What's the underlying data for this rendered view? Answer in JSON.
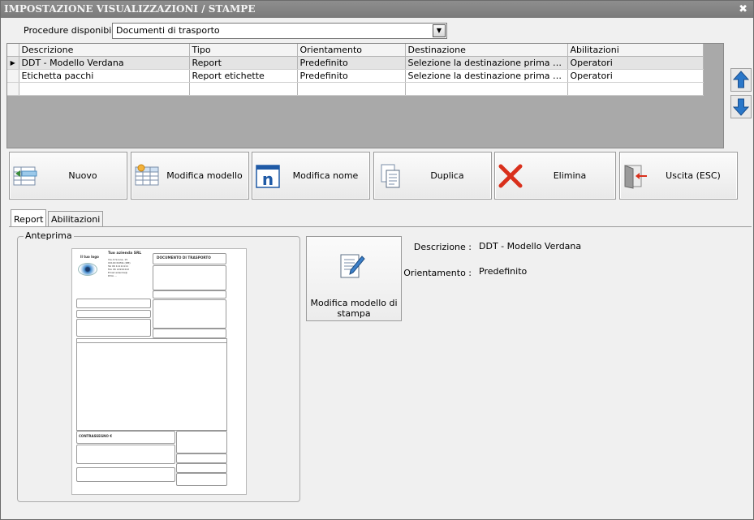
{
  "window": {
    "title": "IMPOSTAZIONE VISUALIZZAZIONI / STAMPE",
    "close_glyph": "✖"
  },
  "procedure": {
    "label": "Procedure disponibili :",
    "value": "Documenti di trasporto"
  },
  "grid": {
    "columns": [
      "Descrizione",
      "Tipo",
      "Orientamento",
      "Destinazione",
      "Abilitazioni"
    ],
    "rows": [
      [
        "DDT - Modello Verdana",
        "Report",
        "Predefinito",
        "Selezione la destinazione prima di stampare",
        "Operatori"
      ],
      [
        "Etichetta pacchi",
        "Report etichette",
        "Predefinito",
        "Selezione la destinazione prima di stampare",
        "Operatori"
      ]
    ]
  },
  "toolbar": {
    "new_label": "Nuovo",
    "edit_model_label": "Modifica modello",
    "edit_name_label": "Modifica nome",
    "duplicate_label": "Duplica",
    "delete_label": "Elimina",
    "exit_label": "Uscita (ESC)"
  },
  "tabs": {
    "report": "Report",
    "permissions": "Abilitazioni"
  },
  "preview": {
    "group_title": "Anteprima",
    "logo_text": "Il tuo logo",
    "company": "Tuo azienda SRL",
    "address_lines": [
      "Via di Scena, 15",
      "00100 ROMA (RM)",
      "Tel 06 11111111",
      "Fax 06 22222222",
      "Email azienda@",
      "P.IVA ..."
    ],
    "doc_title": "DOCUMENTO DI TRASPORTO",
    "cod_label": "CONTRASSEGNO €"
  },
  "details": {
    "edit_template_label": "Modifica modello di stampa",
    "description_label": "Descrizione :",
    "description_value": "DDT - Modello Verdana",
    "orientation_label": "Orientamento :",
    "orientation_value": "Predefinito"
  },
  "icons": {
    "up": "arrow-up-icon",
    "down": "arrow-down-icon",
    "new": "table-add-icon",
    "edit_model": "table-edit-icon",
    "edit_name": "rename-icon",
    "duplicate": "copy-icon",
    "delete": "delete-x-icon",
    "exit": "exit-door-icon",
    "template": "document-pen-icon"
  },
  "colors": {
    "arrow_blue": "#2a77c9",
    "delete_red": "#d9301c",
    "rename_blue": "#1f5aa6"
  }
}
